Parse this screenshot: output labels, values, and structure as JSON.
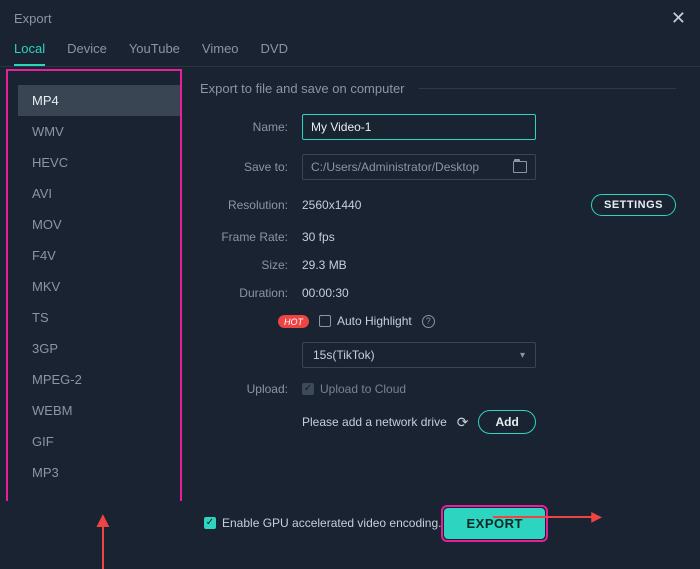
{
  "window": {
    "title": "Export"
  },
  "tabs": {
    "items": [
      "Local",
      "Device",
      "YouTube",
      "Vimeo",
      "DVD"
    ],
    "active": 0
  },
  "formats": {
    "items": [
      "MP4",
      "WMV",
      "HEVC",
      "AVI",
      "MOV",
      "F4V",
      "MKV",
      "TS",
      "3GP",
      "MPEG-2",
      "WEBM",
      "GIF",
      "MP3"
    ],
    "active": 0
  },
  "section": {
    "title": "Export to file and save on computer"
  },
  "fields": {
    "name_label": "Name:",
    "name_value": "My Video-1",
    "save_label": "Save to:",
    "save_value": "C:/Users/Administrator/Desktop",
    "resolution_label": "Resolution:",
    "resolution_value": "2560x1440",
    "framerate_label": "Frame Rate:",
    "framerate_value": "30 fps",
    "size_label": "Size:",
    "size_value": "29.3 MB",
    "duration_label": "Duration:",
    "duration_value": "00:00:30",
    "settings_btn": "SETTINGS",
    "hot_badge": "HOT",
    "auto_highlight": "Auto Highlight",
    "preset_value": "15s(TikTok)",
    "upload_label": "Upload:",
    "upload_text": "Upload to Cloud",
    "network_text": "Please add a network drive",
    "add_btn": "Add"
  },
  "footer": {
    "gpu_text": "Enable GPU accelerated video encoding.",
    "export_btn": "EXPORT"
  }
}
